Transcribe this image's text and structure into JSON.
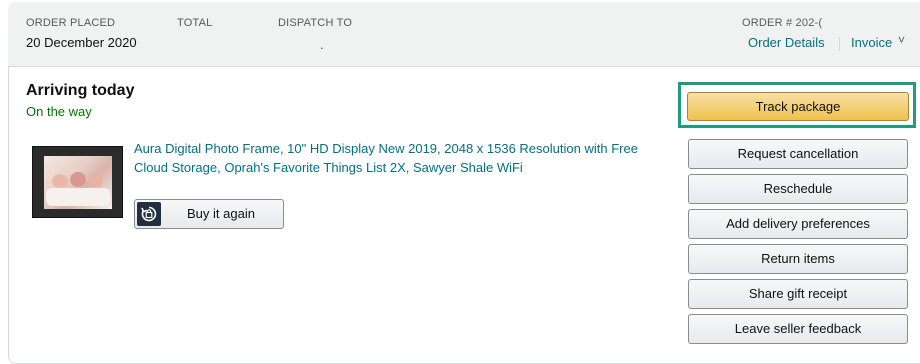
{
  "header": {
    "order_placed_label": "ORDER PLACED",
    "order_placed_value": "20 December 2020",
    "total_label": "TOTAL",
    "dispatch_label": "DISPATCH TO",
    "dispatch_value": ".",
    "order_number_label": "ORDER # 202-(",
    "order_details_link": "Order Details",
    "invoice_link": "Invoice",
    "invoice_chevron": "˅"
  },
  "status": {
    "title": "Arriving today",
    "subtitle": "On the way"
  },
  "product": {
    "title": "Aura Digital Photo Frame, 10\" HD Display New 2019, 2048 x 1536 Resolution with Free Cloud Storage, Oprah's Favorite Things List 2X, Sawyer Shale WiFi",
    "buy_again_label": "Buy it again"
  },
  "actions": {
    "track_package": "Track package",
    "buttons": [
      "Request cancellation",
      "Reschedule",
      "Add delivery preferences",
      "Return items",
      "Share gift receipt",
      "Leave seller feedback"
    ]
  },
  "colors": {
    "link": "#007185",
    "status_green": "#007600",
    "track_button": "#f0c14b",
    "highlight_border": "#1a9e7d"
  }
}
